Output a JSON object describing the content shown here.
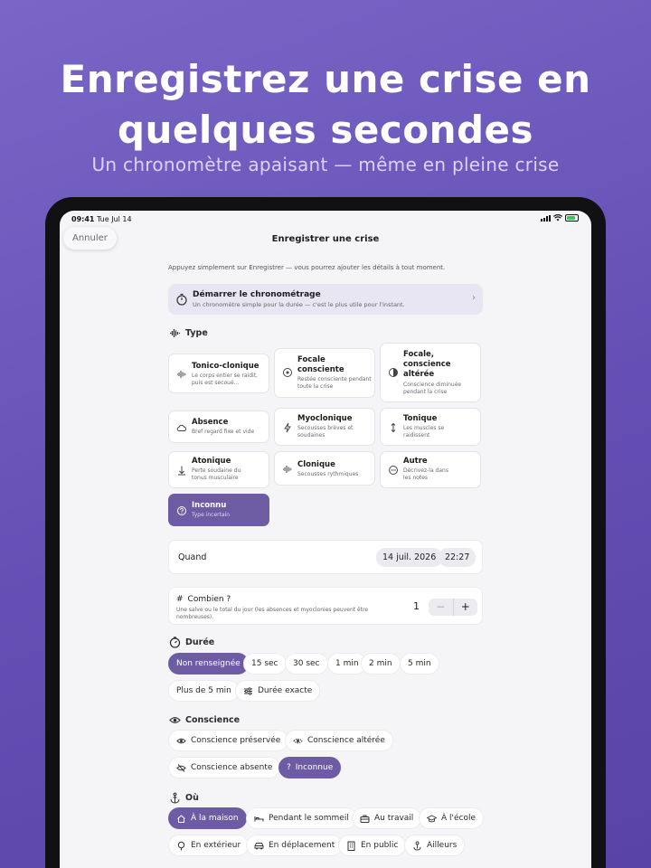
{
  "headline": "Enregistrez une crise en quelques secondes",
  "subheadline": "Un chronomètre apaisant — même en pleine crise",
  "status": {
    "time": "09:41",
    "date": "Tue Jul 14"
  },
  "nav": {
    "cancel": "Annuler",
    "title": "Enregistrer une crise"
  },
  "hint": "Appuyez simplement sur Enregistrer — vous pourrez ajouter les détails à tout moment.",
  "timer": {
    "title": "Démarrer le chronométrage",
    "subtitle": "Un chronomètre simple pour la durée — c'est le plus utile pour l'instant."
  },
  "type_section": {
    "label": "Type",
    "cards": [
      {
        "title": "Tonico-clonique",
        "desc": "Le corps entier se raidit, puis est secoué…",
        "icon": "waveform-icon"
      },
      {
        "title": "Focale consciente",
        "desc": "Restée consciente pendant toute la crise",
        "icon": "target-icon"
      },
      {
        "title": "Focale, conscience altérée",
        "desc": "Conscience diminuée pendant la crise",
        "icon": "half-circle-icon"
      },
      {
        "title": "Absence",
        "desc": "Bref regard fixe et vide",
        "icon": "cloud-icon"
      },
      {
        "title": "Myoclonique",
        "desc": "Secousses brèves et soudaines",
        "icon": "bolt-icon"
      },
      {
        "title": "Tonique",
        "desc": "Les muscles se raidissent",
        "icon": "arrows-vertical-icon"
      },
      {
        "title": "Atonique",
        "desc": "Perte soudaine du tonus musculaire",
        "icon": "arrow-down-icon"
      },
      {
        "title": "Clonique",
        "desc": "Secousses rythmiques",
        "icon": "waveform-icon"
      },
      {
        "title": "Autre",
        "desc": "Décrivez-la dans les notes",
        "icon": "ellipsis-circle-icon"
      },
      {
        "title": "Inconnu",
        "desc": "Type incertain",
        "icon": "question-circle-icon",
        "selected": true
      }
    ]
  },
  "when": {
    "label": "Quand",
    "date": "14 juil. 2026",
    "time": "22:27"
  },
  "count": {
    "label": "Combien ?",
    "sub": "Une salve ou le total du jour (les absences et myoclonies peuvent être nombreuses).",
    "value": "1",
    "minus": "−",
    "plus": "+"
  },
  "duration": {
    "label": "Durée",
    "options": [
      "Non renseignée",
      "15 sec",
      "30 sec",
      "1 min",
      "2 min",
      "5 min",
      "Plus de 5 min",
      "Durée exacte"
    ],
    "selected": "Non renseignée"
  },
  "awareness": {
    "label": "Conscience",
    "options": [
      "Conscience préservée",
      "Conscience altérée",
      "Conscience absente",
      "Inconnue"
    ],
    "selected": "Inconnue"
  },
  "location": {
    "label": "Où",
    "options": [
      "À la maison",
      "Pendant le sommeil",
      "Au travail",
      "À l'école",
      "En extérieur",
      "En déplacement",
      "En public",
      "Ailleurs"
    ],
    "selected": "À la maison"
  },
  "colors": {
    "accent": "#6d5ca4",
    "background": "#6450b4"
  }
}
